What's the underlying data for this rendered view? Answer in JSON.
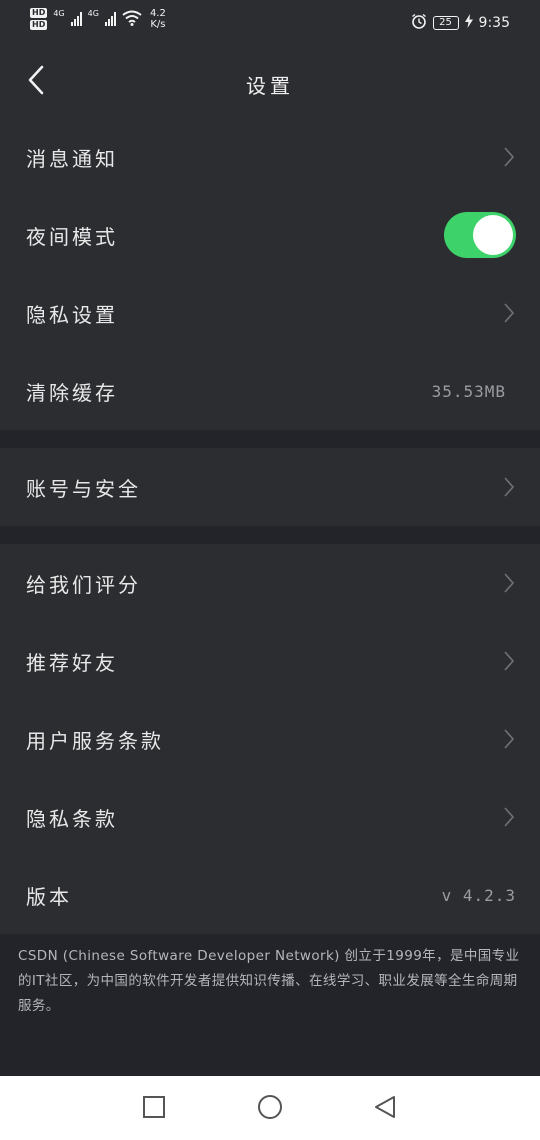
{
  "status_bar": {
    "hd1": "HD",
    "hd2": "HD",
    "network1": "4G",
    "network2": "4G",
    "speed_value": "4.2",
    "speed_unit": "K/s",
    "battery": "25",
    "time": "9:35"
  },
  "header": {
    "title": "设置"
  },
  "groups": [
    {
      "items": [
        {
          "label": "消息通知"
        },
        {
          "label": "夜间模式",
          "toggle_on": true
        },
        {
          "label": "隐私设置"
        },
        {
          "label": "清除缓存",
          "value": "35.53MB"
        }
      ]
    },
    {
      "items": [
        {
          "label": "账号与安全"
        }
      ]
    },
    {
      "items": [
        {
          "label": "给我们评分"
        },
        {
          "label": "推荐好友"
        },
        {
          "label": "用户服务条款"
        },
        {
          "label": "隐私条款"
        },
        {
          "label": "版本",
          "value": "v 4.2.3"
        }
      ]
    }
  ],
  "about_text": "CSDN (Chinese Software Developer Network) 创立于1999年，是中国专业的IT社区，为中国的软件开发者提供知识传播、在线学习、职业发展等全生命周期服务。",
  "colors": {
    "toggle_on": "#3dd26a",
    "background": "#23242a",
    "row_background": "#2b2d31"
  }
}
